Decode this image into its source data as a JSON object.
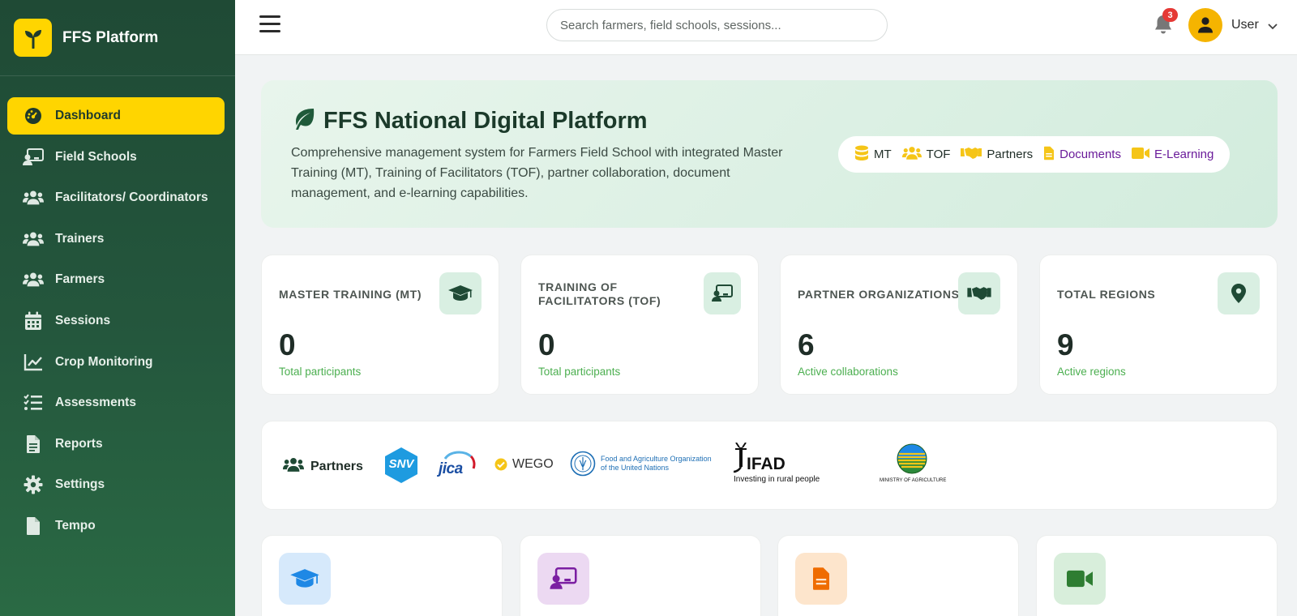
{
  "brand": {
    "name": "FFS Platform"
  },
  "sidebar": {
    "items": [
      {
        "label": "Dashboard",
        "icon": "gauge-icon",
        "active": true
      },
      {
        "label": "Field Schools",
        "icon": "chalkboard-teacher-icon",
        "active": false
      },
      {
        "label": "Facilitators/ Coordinators",
        "icon": "users-icon",
        "active": false
      },
      {
        "label": "Trainers",
        "icon": "users-icon",
        "active": false
      },
      {
        "label": "Farmers",
        "icon": "users-icon",
        "active": false
      },
      {
        "label": "Sessions",
        "icon": "calendar-icon",
        "active": false
      },
      {
        "label": "Crop Monitoring",
        "icon": "chart-line-icon",
        "active": false
      },
      {
        "label": "Assessments",
        "icon": "list-check-icon",
        "active": false
      },
      {
        "label": "Reports",
        "icon": "file-lines-icon",
        "active": false
      },
      {
        "label": "Settings",
        "icon": "gear-icon",
        "active": false
      },
      {
        "label": "Tempo",
        "icon": "file-icon",
        "active": false
      }
    ]
  },
  "topbar": {
    "search_placeholder": "Search farmers, field schools, sessions...",
    "notifications_count": "3",
    "user_name": "User"
  },
  "hero": {
    "title": "FFS National Digital Platform",
    "description": "Comprehensive management system for Farmers Field School with integrated Master Training (MT), Training of Facilitators (TOF), partner collaboration, document management, and e-learning capabilities.",
    "pills": [
      {
        "label": "MT",
        "icon": "database-icon"
      },
      {
        "label": "TOF",
        "icon": "users-icon"
      },
      {
        "label": "Partners",
        "icon": "handshake-icon"
      },
      {
        "label": "Documents",
        "icon": "file-icon"
      },
      {
        "label": "E-Learning",
        "icon": "video-icon"
      }
    ]
  },
  "stats": [
    {
      "label": "MASTER TRAINING (MT)",
      "value": "0",
      "sub": "Total participants",
      "icon": "graduation-cap-icon"
    },
    {
      "label": "TRAINING OF FACILITATORS (TOF)",
      "value": "0",
      "sub": "Total participants",
      "icon": "chalkboard-teacher-icon"
    },
    {
      "label": "PARTNER ORGANIZATIONS",
      "value": "6",
      "sub": "Active collaborations",
      "icon": "handshake-icon"
    },
    {
      "label": "TOTAL REGIONS",
      "value": "9",
      "sub": "Active regions",
      "icon": "map-pin-icon"
    }
  ],
  "partners": {
    "title": "Partners",
    "logos": [
      {
        "name": "SNV",
        "text": "SNV"
      },
      {
        "name": "JICA",
        "text": "JICA"
      },
      {
        "name": "WEGO",
        "text": "WEGO"
      },
      {
        "name": "FAO",
        "line1": "Food and Agriculture Organization",
        "line2": "of the United Nations"
      },
      {
        "name": "IFAD",
        "text": "IFAD",
        "tagline": "Investing in rural people"
      },
      {
        "name": "Ministry of Agriculture",
        "text": "MINISTRY OF AGRICULTURE"
      }
    ]
  },
  "features": [
    {
      "icon": "graduation-cap-icon",
      "color": "#1e88e5",
      "bg": "#d6e9fb"
    },
    {
      "icon": "chalkboard-teacher-icon",
      "color": "#7b1fa2",
      "bg": "#ecd9f2"
    },
    {
      "icon": "file-icon",
      "color": "#ef6c00",
      "bg": "#fde5cc"
    },
    {
      "icon": "video-icon",
      "color": "#2e7d32",
      "bg": "#d8eedb"
    }
  ],
  "colors": {
    "sidebar": "#1f4a35",
    "accent": "#ffd500",
    "stat_sub": "#4caf50",
    "badge": "#e53935"
  }
}
